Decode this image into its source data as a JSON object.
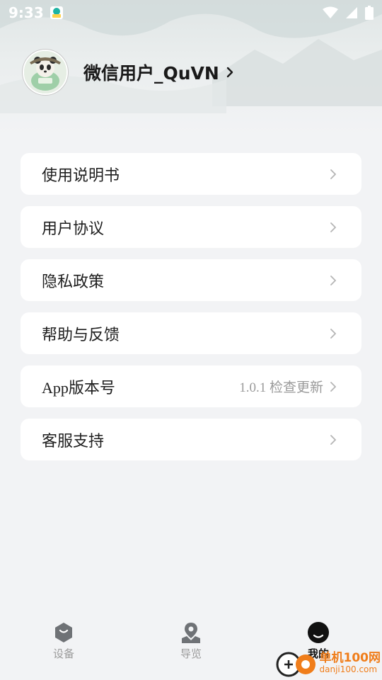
{
  "status_bar": {
    "time": "9:33",
    "icons": [
      "app-notification-icon",
      "wifi-icon",
      "cell-signal-icon",
      "battery-icon"
    ]
  },
  "profile": {
    "username": "微信用户_QuVN",
    "avatar_icon": "panda-avatar-icon"
  },
  "menu": {
    "items": [
      {
        "label": "使用说明书",
        "value": ""
      },
      {
        "label": "用户协议",
        "value": ""
      },
      {
        "label": "隐私政策",
        "value": ""
      },
      {
        "label": "帮助与反馈",
        "value": ""
      },
      {
        "label": "App版本号",
        "value": "1.0.1 检查更新"
      },
      {
        "label": "客服支持",
        "value": ""
      }
    ]
  },
  "tab_bar": {
    "tabs": [
      {
        "label": "设备",
        "icon": "device-hexagon-icon",
        "active": false
      },
      {
        "label": "导览",
        "icon": "map-pin-icon",
        "active": false
      },
      {
        "label": "我的",
        "icon": "profile-face-icon",
        "active": true
      }
    ]
  },
  "watermark": {
    "cn": "单机100网",
    "en": "danji100.com"
  },
  "colors": {
    "background": "#f2f3f5",
    "card": "#ffffff",
    "text": "#1e1e1e",
    "muted": "#9a9a9a",
    "watermark": "#f07d1a"
  }
}
